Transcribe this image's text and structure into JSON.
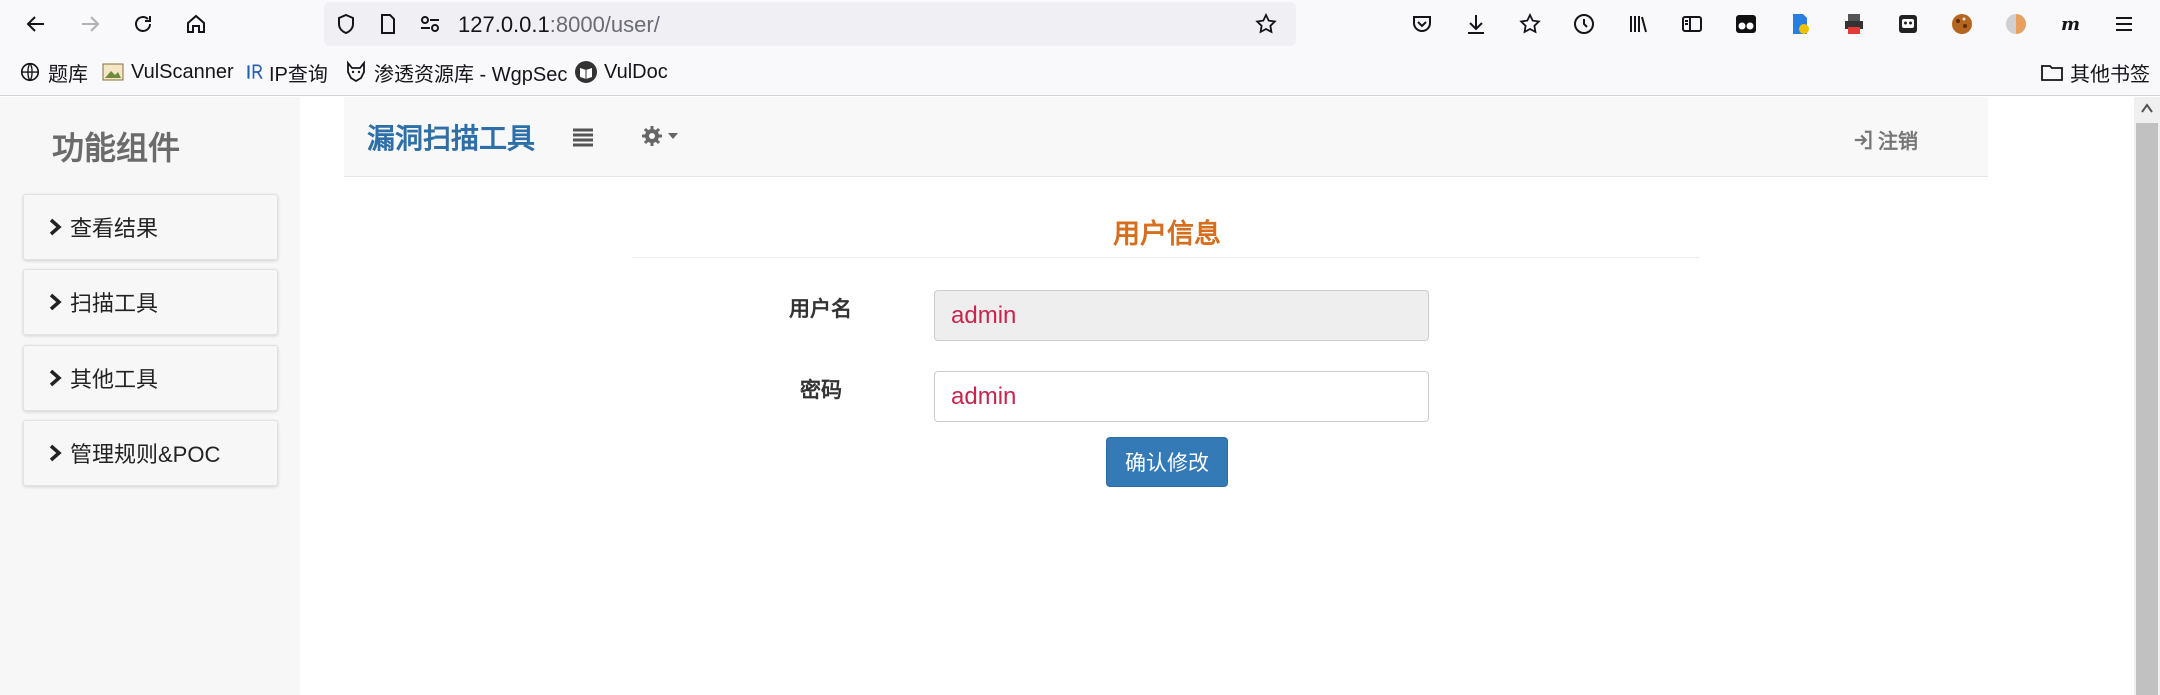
{
  "browser": {
    "url_host": "127.0.0.1",
    "url_rest": ":8000/user/"
  },
  "bookmarks": {
    "items": [
      {
        "label": "题库",
        "icon": "globe-icon"
      },
      {
        "label": "VulScanner",
        "icon": "image-icon"
      },
      {
        "label": "IP查询",
        "icon": "ip-icon"
      },
      {
        "label": "渗透资源库 - WgpSec",
        "icon": "wolf-icon"
      },
      {
        "label": "VulDoc",
        "icon": "book-icon"
      }
    ],
    "other_folder": "其他书签"
  },
  "sidebar": {
    "title": "功能组件",
    "items": [
      {
        "label": "查看结果"
      },
      {
        "label": "扫描工具"
      },
      {
        "label": "其他工具"
      },
      {
        "label": "管理规则&POC"
      }
    ]
  },
  "navbar": {
    "brand": "漏洞扫描工具",
    "logout_label": "注销"
  },
  "main": {
    "section_title": "用户信息",
    "username_label": "用户名",
    "username_value": "admin",
    "password_label": "密码",
    "password_value": "admin",
    "submit_label": "确认修改"
  },
  "colors": {
    "brand": "#2f6fa8",
    "section_title": "#d66e1e",
    "input_text": "#c7254e",
    "button": "#337ab7"
  }
}
